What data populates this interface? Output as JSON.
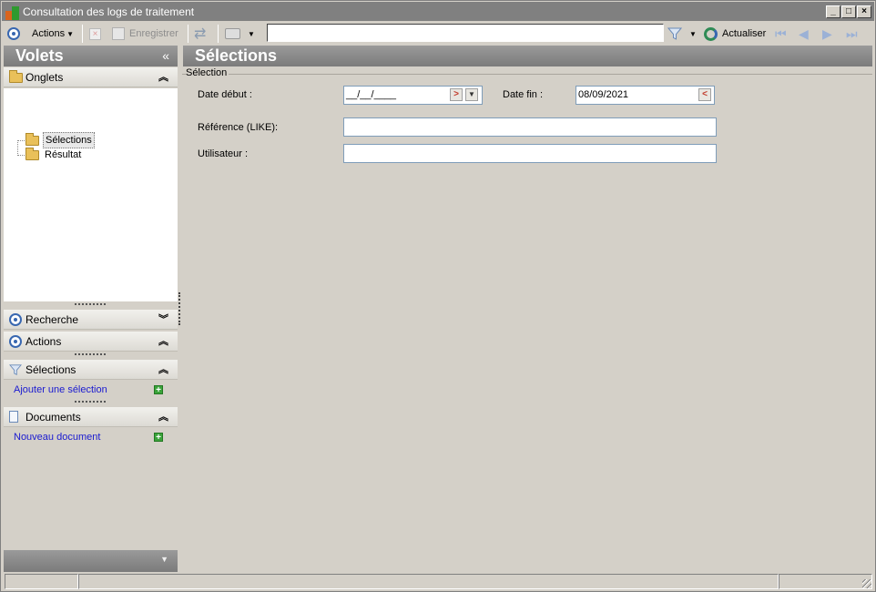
{
  "window": {
    "title": "Consultation des logs de traitement",
    "controls": [
      "_",
      "□",
      "×"
    ]
  },
  "toolbar": {
    "actions_label": "Actions",
    "save_label": "Enregistrer",
    "search_value": "",
    "refresh_label": "Actualiser"
  },
  "left_pane": {
    "title": "Volets",
    "collapse_glyph": "«",
    "onglets": {
      "label": "Onglets",
      "items": [
        {
          "label": "Sélections",
          "selected": true
        },
        {
          "label": "Résultat",
          "selected": false
        }
      ]
    },
    "recherche": {
      "label": "Recherche"
    },
    "actions": {
      "label": "Actions"
    },
    "selections": {
      "label": "Sélections",
      "link": "Ajouter une sélection"
    },
    "documents": {
      "label": "Documents",
      "link": "Nouveau document"
    }
  },
  "main": {
    "title": "Sélections",
    "fieldset_legend": "Sélection",
    "fields": {
      "date_debut": {
        "label": "Date début :",
        "value": "__/__/____"
      },
      "date_fin": {
        "label": "Date fin :",
        "value": "08/09/2021"
      },
      "reference": {
        "label": "Référence (LIKE):",
        "value": ""
      },
      "utilisateur": {
        "label": "Utilisateur :",
        "value": ""
      }
    }
  },
  "colors": {
    "panel_header": "#858585",
    "link": "#1a1ad0",
    "accent_blue": "#3867b0"
  }
}
